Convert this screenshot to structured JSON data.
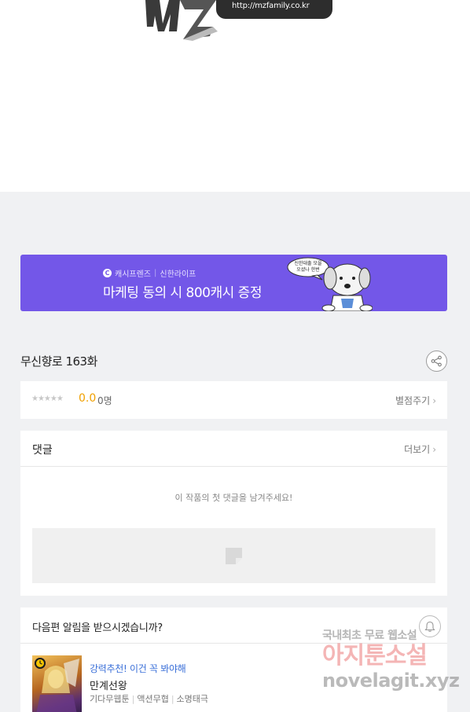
{
  "top_image": {
    "logo_url_text": "http://mzfamily.co.kr"
  },
  "banner": {
    "brand_icon": "C",
    "brand_left": "캐시프렌즈",
    "brand_right": "신한라이프",
    "title": "마케팅 동의 시 800캐시 증정",
    "bubble_text": "신한대출 모집 오셨나 한번 들어가",
    "bg_color": "#7357e8"
  },
  "episode": {
    "title": "무신향로 163화",
    "share_icon": "share-icon"
  },
  "rating": {
    "stars": "★★★★★",
    "score": "0.0",
    "count": "0명",
    "rate_link": "별점주기",
    "score_color": "#f0a000"
  },
  "comments": {
    "heading": "댓글",
    "more": "더보기",
    "empty_text": "이 작품의 첫 댓글을 남겨주세요!"
  },
  "next_episode": {
    "heading": "다음편 알림을 받으시겠습니까?",
    "bell_icon": "bell-icon",
    "recommend_label": "강력추천! 이건 꼭 봐야해",
    "recommend_title": "만계선왕",
    "meta": [
      "기다무웹툰",
      "액션무협",
      "소명태극"
    ]
  },
  "watermark": {
    "line1": "국내최초 무료 웹소설",
    "line2": "아지툰소설",
    "line3": "novelagit.xyz"
  }
}
